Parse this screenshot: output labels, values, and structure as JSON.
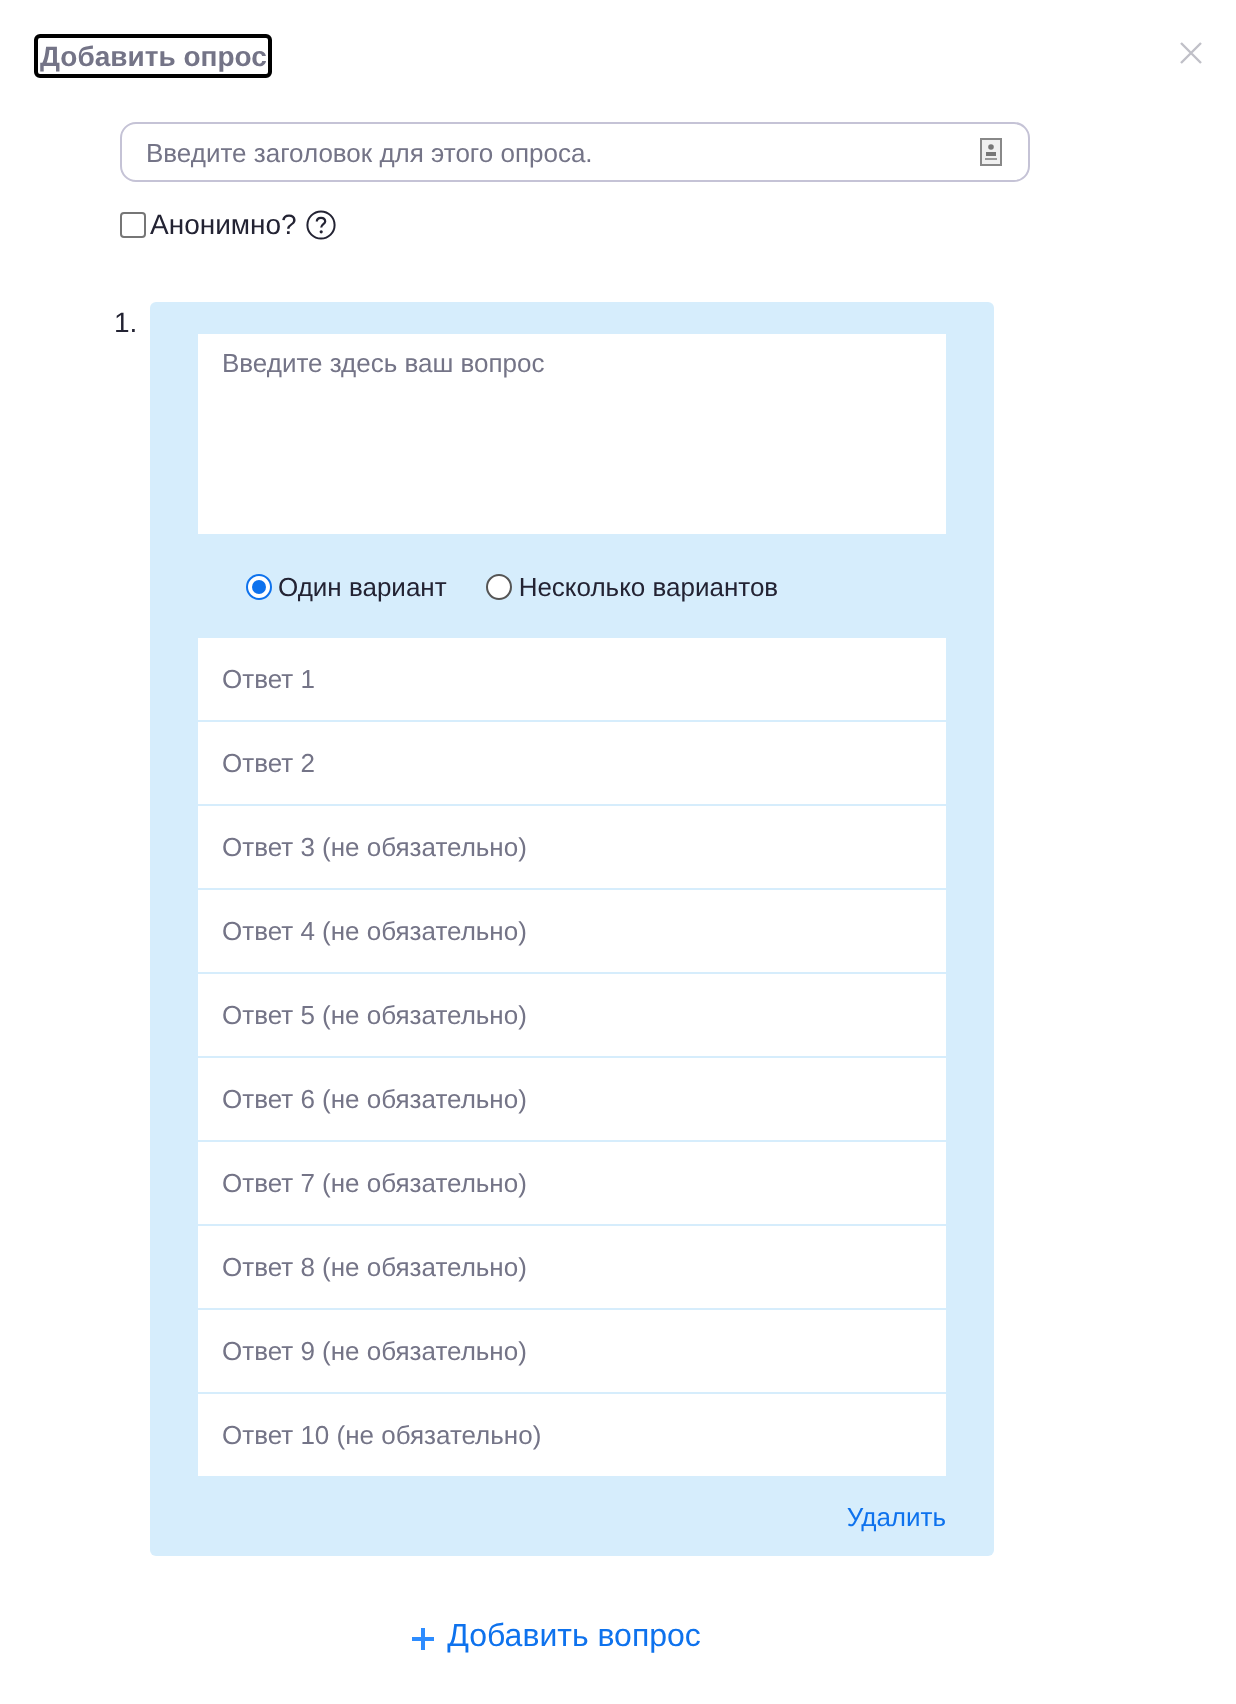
{
  "dialog": {
    "title": "Добавить опрос",
    "title_focused": true
  },
  "poll_title": {
    "placeholder": "Введите заголовок для этого опроса."
  },
  "anonymous": {
    "label": "Анонимно?",
    "checked": false
  },
  "questions": [
    {
      "number": "1.",
      "question": {
        "placeholder": "Введите здесь ваш вопрос"
      },
      "answer_types": [
        {
          "label": "Один вариант",
          "selected": true
        },
        {
          "label": "Несколько вариантов",
          "selected": false
        }
      ],
      "answers": [
        {
          "placeholder": "Ответ 1"
        },
        {
          "placeholder": "Ответ 2"
        },
        {
          "placeholder": "Ответ 3 (не обязательно)"
        },
        {
          "placeholder": "Ответ 4 (не обязательно)"
        },
        {
          "placeholder": "Ответ 5 (не обязательно)"
        },
        {
          "placeholder": "Ответ 6 (не обязательно)"
        },
        {
          "placeholder": "Ответ 7 (не обязательно)"
        },
        {
          "placeholder": "Ответ 8 (не обязательно)"
        },
        {
          "placeholder": "Ответ 9 (не обязательно)"
        },
        {
          "placeholder": "Ответ 10 (не обязательно)"
        }
      ],
      "delete_label": "Удалить"
    }
  ],
  "add_question": {
    "label": "Добавить вопрос"
  }
}
